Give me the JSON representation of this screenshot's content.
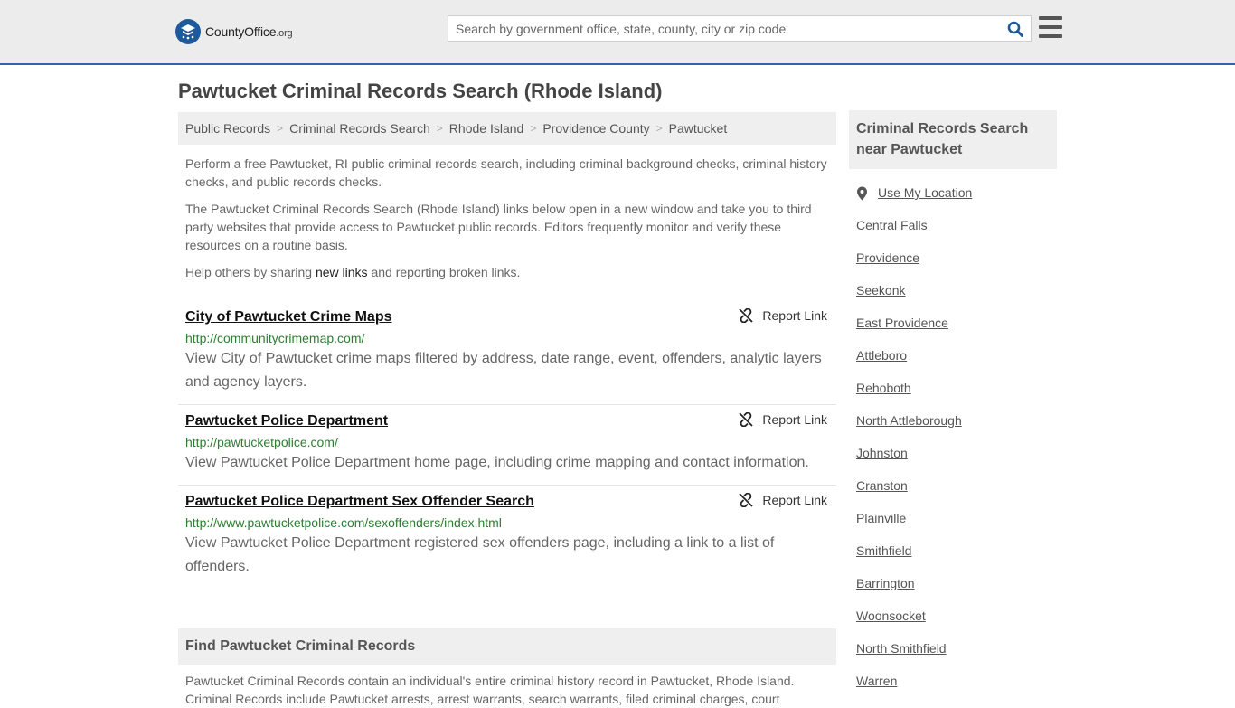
{
  "header": {
    "logo_name": "County",
    "logo_bold": "Office",
    "logo_tld": ".org",
    "search_placeholder": "Search by government office, state, county, city or zip code"
  },
  "page_title": "Pawtucket Criminal Records Search (Rhode Island)",
  "breadcrumb": [
    "Public Records",
    "Criminal Records Search",
    "Rhode Island",
    "Providence County",
    "Pawtucket"
  ],
  "intro": {
    "p1": "Perform a free Pawtucket, RI public criminal records search, including criminal background checks, criminal history checks, and public records checks.",
    "p2": "The Pawtucket Criminal Records Search (Rhode Island) links below open in a new window and take you to third party websites that provide access to Pawtucket public records. Editors frequently monitor and verify these resources on a routine basis.",
    "p3_before": "Help others by sharing ",
    "p3_link": "new links",
    "p3_after": " and reporting broken links."
  },
  "report_label": "Report Link",
  "results": [
    {
      "title": "City of Pawtucket Crime Maps",
      "url": "http://communitycrimemap.com/",
      "desc": "View City of Pawtucket crime maps filtered by address, date range, event, offenders, analytic layers and agency layers."
    },
    {
      "title": "Pawtucket Police Department",
      "url": "http://pawtucketpolice.com/",
      "desc": "View Pawtucket Police Department home page, including crime mapping and contact information."
    },
    {
      "title": "Pawtucket Police Department Sex Offender Search",
      "url": "http://www.pawtucketpolice.com/sexoffenders/index.html",
      "desc": "View Pawtucket Police Department registered sex offenders page, including a link to a list of offenders."
    }
  ],
  "find_section": {
    "heading": "Find Pawtucket Criminal Records",
    "body": "Pawtucket Criminal Records contain an individual's entire criminal history record in Pawtucket, Rhode Island. Criminal Records include Pawtucket arrests, arrest warrants, search warrants, filed criminal charges, court"
  },
  "sidebar": {
    "heading": "Criminal Records Search near Pawtucket",
    "use_location": "Use My Location",
    "places": [
      "Central Falls",
      "Providence",
      "Seekonk",
      "East Providence",
      "Attleboro",
      "Rehoboth",
      "North Attleborough",
      "Johnston",
      "Cranston",
      "Plainville",
      "Smithfield",
      "Barrington",
      "Woonsocket",
      "North Smithfield",
      "Warren"
    ]
  }
}
